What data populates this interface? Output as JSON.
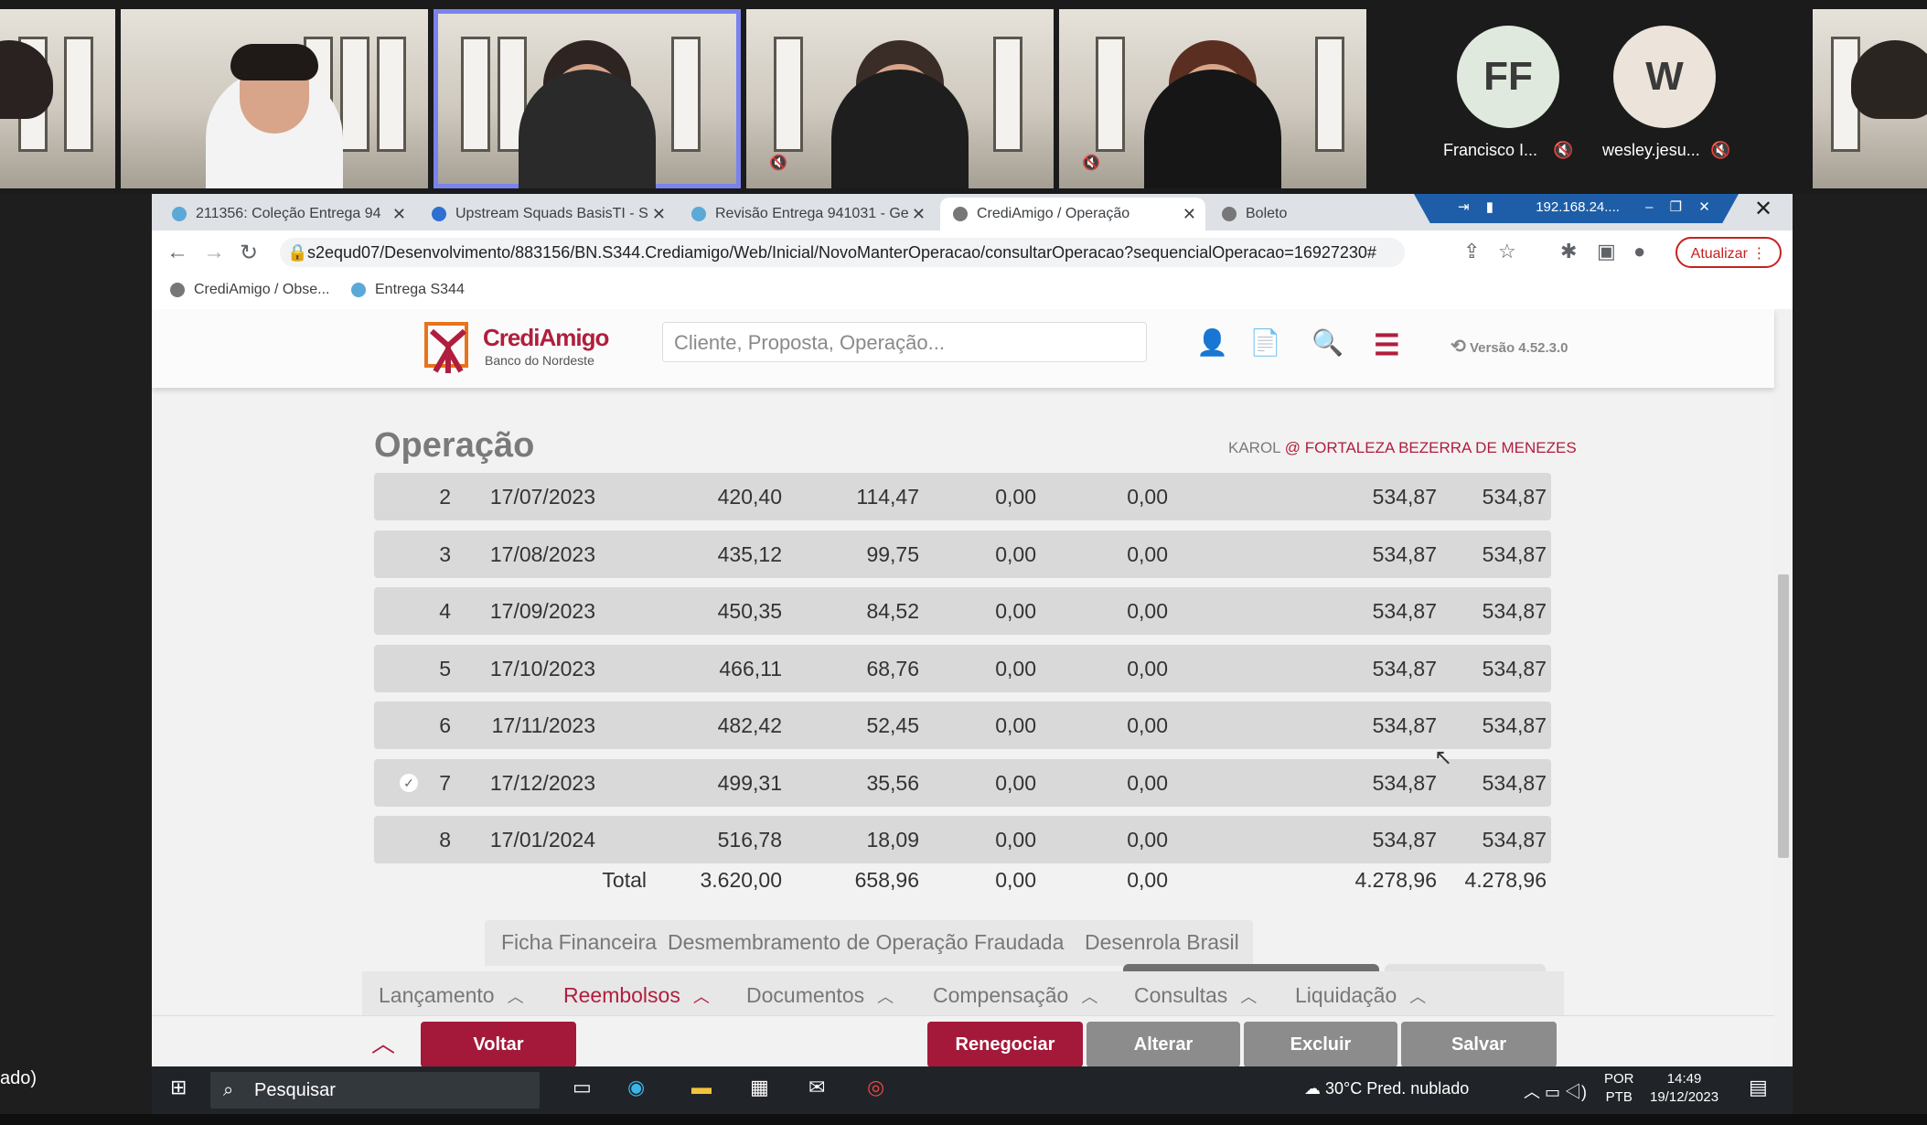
{
  "meeting": {
    "participants": [
      {
        "initials": "FF",
        "name": "Francisco I...",
        "color": "#dfe9dd"
      },
      {
        "initials": "W",
        "name": "wesley.jesu...",
        "color": "#ece3da"
      }
    ]
  },
  "browser": {
    "tabs": [
      {
        "title": "211356: Coleção Entrega 94",
        "active": false
      },
      {
        "title": "Upstream Squads BasisTI - S",
        "active": false
      },
      {
        "title": "Revisão Entrega 941031 - Ge",
        "active": false
      },
      {
        "title": "CrediAmigo / Operação",
        "active": true
      },
      {
        "title": "Boleto",
        "active": false
      }
    ],
    "remote_label": "192.168.24....",
    "url": "s2equd07/Desenvolvimento/883156/BN.S344.Crediamigo/Web/Inicial/NovoManterOperacao/consultarOperacao?sequencialOperacao=16927230#",
    "update_label": "Atualizar",
    "bookmarks": [
      "CrediAmigo / Obse...",
      "Entrega S344"
    ]
  },
  "app": {
    "logo_title": "CrediAmigo",
    "logo_subtitle": "Banco do Nordeste",
    "search_placeholder": "Cliente, Proposta, Operação...",
    "version": "Versão 4.52.3.0",
    "section_title": "Operação",
    "user": "KAROL",
    "at": "@",
    "branch": "FORTALEZA BEZERRA DE MENEZES",
    "rows": [
      {
        "n": "2",
        "date": "17/07/2023",
        "a": "420,40",
        "b": "114,47",
        "c": "0,00",
        "d": "0,00",
        "e": "534,87",
        "f": "534,87",
        "checked": false
      },
      {
        "n": "3",
        "date": "17/08/2023",
        "a": "435,12",
        "b": "99,75",
        "c": "0,00",
        "d": "0,00",
        "e": "534,87",
        "f": "534,87",
        "checked": false
      },
      {
        "n": "4",
        "date": "17/09/2023",
        "a": "450,35",
        "b": "84,52",
        "c": "0,00",
        "d": "0,00",
        "e": "534,87",
        "f": "534,87",
        "checked": false
      },
      {
        "n": "5",
        "date": "17/10/2023",
        "a": "466,11",
        "b": "68,76",
        "c": "0,00",
        "d": "0,00",
        "e": "534,87",
        "f": "534,87",
        "checked": false
      },
      {
        "n": "6",
        "date": "17/11/2023",
        "a": "482,42",
        "b": "52,45",
        "c": "0,00",
        "d": "0,00",
        "e": "534,87",
        "f": "534,87",
        "checked": false
      },
      {
        "n": "7",
        "date": "17/12/2023",
        "a": "499,31",
        "b": "35,56",
        "c": "0,00",
        "d": "0,00",
        "e": "534,87",
        "f": "534,87",
        "checked": true
      },
      {
        "n": "8",
        "date": "17/01/2024",
        "a": "516,78",
        "b": "18,09",
        "c": "0,00",
        "d": "0,00",
        "e": "534,87",
        "f": "534,87",
        "checked": false
      }
    ],
    "total": {
      "label": "Total",
      "a": "3.620,00",
      "b": "658,96",
      "c": "0,00",
      "d": "0,00",
      "e": "4.278,96",
      "f": "4.278,96"
    },
    "subtabs": [
      "Ficha Financeira",
      "Desmembramento de Operação Fraudada",
      "Desenrola Brasil"
    ],
    "bottom_nav": [
      "Lançamento",
      "Reembolsos",
      "Documentos",
      "Compensação",
      "Consultas",
      "Liquidação"
    ],
    "buttons": {
      "voltar": "Voltar",
      "renegociar": "Renegociar",
      "alterar": "Alterar",
      "excluir": "Excluir",
      "salvar": "Salvar"
    }
  },
  "taskbar": {
    "search": "Pesquisar",
    "weather": "30°C  Pred. nublado",
    "lang1": "POR",
    "lang2": "PTB",
    "time": "14:49",
    "date": "19/12/2023",
    "left_label": "ado)"
  }
}
